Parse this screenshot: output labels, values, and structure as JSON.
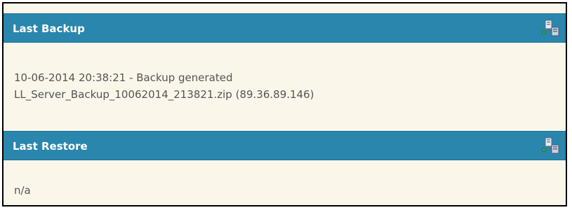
{
  "sections": {
    "last_backup": {
      "title": "Last Backup",
      "icon": "server-network-icon",
      "line1": "10-06-2014 20:38:21 - Backup generated",
      "line2": "LL_Server_Backup_10062014_213821.zip (89.36.89.146)"
    },
    "last_restore": {
      "title": "Last Restore",
      "icon": "server-network-icon",
      "line1": "n/a"
    }
  },
  "colors": {
    "header_bg": "#2a86ad",
    "panel_bg": "#faf7ea",
    "text": "#555555",
    "header_text": "#ffffff"
  }
}
